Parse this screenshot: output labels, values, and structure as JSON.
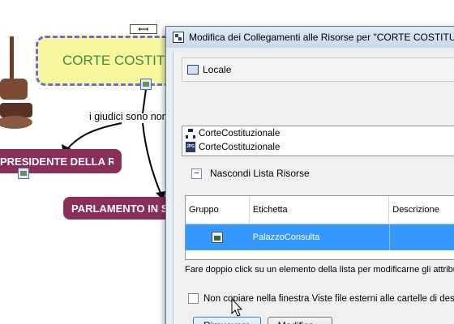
{
  "map": {
    "corte_label": "CORTE COSTITUZIONALE",
    "presidente_label": "PRESIDENTE DELLA REPUBBLICA",
    "parlamento_label": "PARLAMENTO IN SEDUTA COMUNE",
    "link_phrase": "i giudici sono nominati"
  },
  "dialog": {
    "title": "Modifica dei Collegamenti alle Risorse per \"CORTE COSTITUZIONALE\"",
    "location": "Locale",
    "resources": [
      {
        "label": "CorteCostituzionale",
        "icon": "tree-icon"
      },
      {
        "label": "CorteCostituzionale",
        "icon": "jpg-icon"
      }
    ],
    "hide_list_label": "Nascondi Lista Risorse",
    "table": {
      "columns": [
        "Gruppo",
        "Etichetta",
        "Descrizione"
      ],
      "rows": [
        {
          "gruppo_icon": "image-icon",
          "etichetta": "PalazzoConsulta",
          "descrizione": ""
        }
      ]
    },
    "hint": "Fare doppio click su un elemento della lista per modificarne gli attributi",
    "checkbox_label": "Non copiare nella finestra Viste file esterni alle cartelle di destinazione",
    "remove_button": "Rimuovere",
    "modify_button": "Modifica..."
  },
  "colors": {
    "selection": "#3399ff",
    "node_bg": "#8a2f5a",
    "corte_bg": "#f7f7a0",
    "corte_border": "#6a6ae0"
  }
}
